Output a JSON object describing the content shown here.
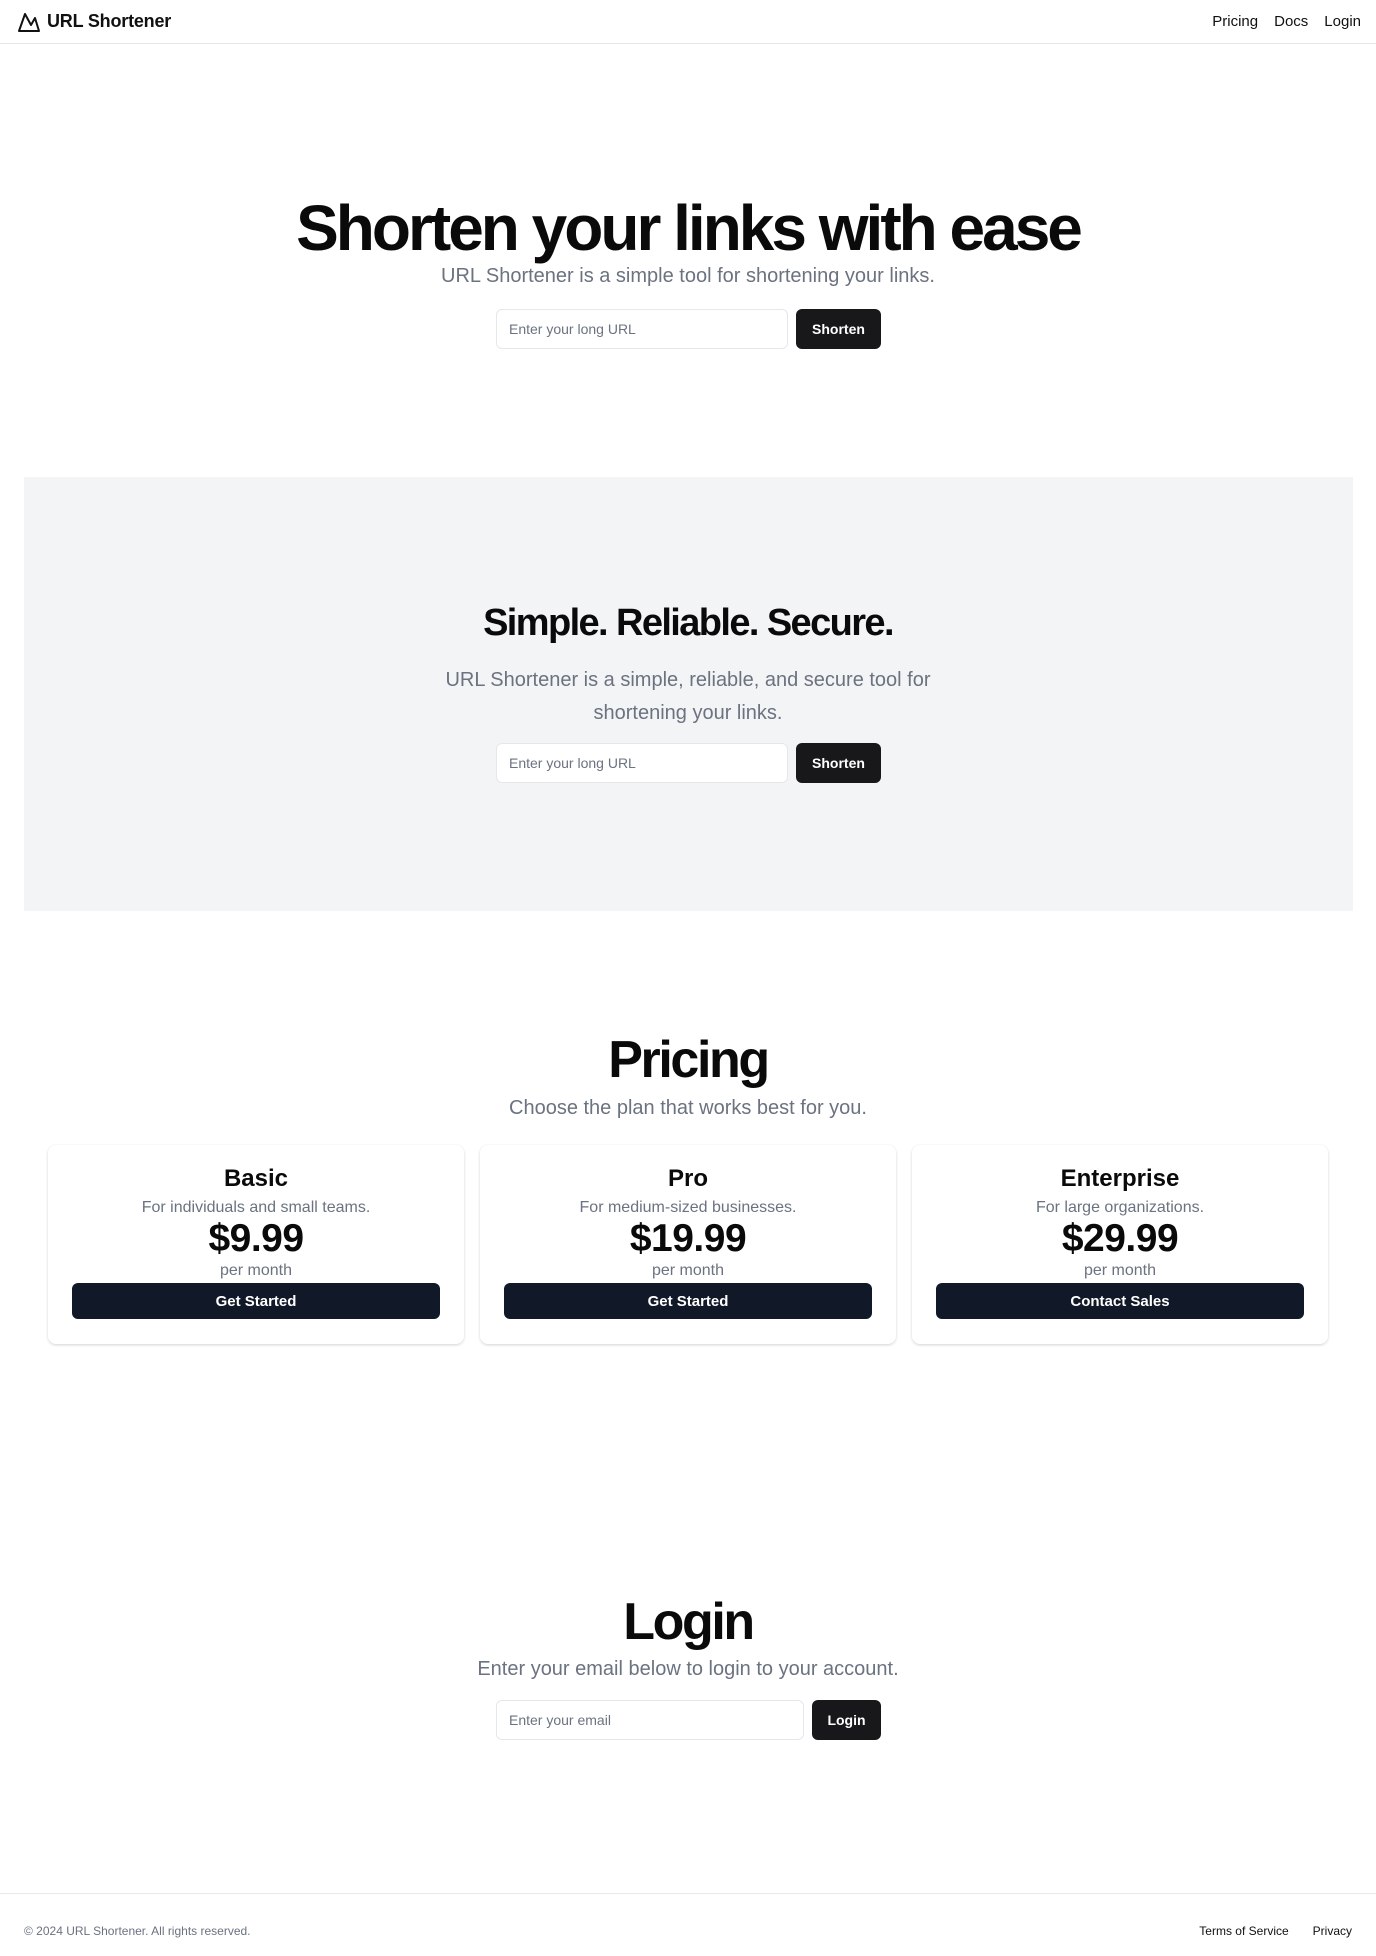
{
  "header": {
    "brand": "URL Shortener",
    "nav": [
      "Pricing",
      "Docs",
      "Login"
    ]
  },
  "hero": {
    "title": "Shorten your links with ease",
    "subtitle": "URL Shortener is a simple tool for shortening your links.",
    "input_placeholder": "Enter your long URL",
    "button": "Shorten"
  },
  "features": {
    "title": "Simple. Reliable. Secure.",
    "subtitle_line1": "URL Shortener is a simple, reliable, and secure tool for",
    "subtitle_line2": "shortening your links.",
    "input_placeholder": "Enter your long URL",
    "button": "Shorten"
  },
  "pricing": {
    "title": "Pricing",
    "subtitle": "Choose the plan that works best for you.",
    "plans": [
      {
        "name": "Basic",
        "description": "For individuals and small teams.",
        "price": "$9.99",
        "period": "per month",
        "button": "Get Started"
      },
      {
        "name": "Pro",
        "description": "For medium-sized businesses.",
        "price": "$19.99",
        "period": "per month",
        "button": "Get Started"
      },
      {
        "name": "Enterprise",
        "description": "For large organizations.",
        "price": "$29.99",
        "period": "per month",
        "button": "Contact Sales"
      }
    ]
  },
  "login": {
    "title": "Login",
    "subtitle": "Enter your email below to login to your account.",
    "input_placeholder": "Enter your email",
    "button": "Login"
  },
  "footer": {
    "copyright": "© 2024 URL Shortener. All rights reserved.",
    "links": [
      "Terms of Service",
      "Privacy"
    ]
  },
  "icons": {
    "brand": "mountain-icon"
  },
  "colors": {
    "primary_button": "#18181b",
    "card_button": "#111827",
    "muted_text": "#6b7280",
    "band_background": "#f3f4f6"
  }
}
